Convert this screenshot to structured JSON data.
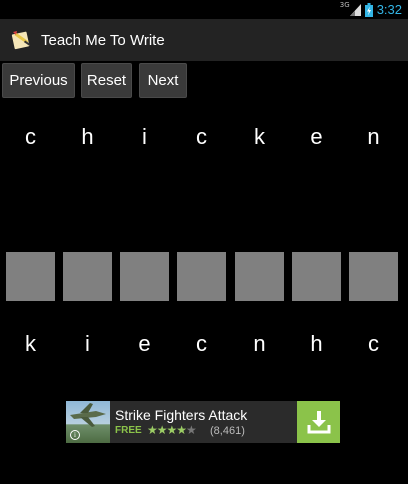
{
  "status_bar": {
    "network_type": "3G",
    "time": "3:32",
    "icons": [
      "signal-icon",
      "battery-charging-icon"
    ]
  },
  "app": {
    "title": "Teach Me To Write",
    "icon": "pencil-notebook-icon"
  },
  "toolbar": {
    "previous_label": "Previous",
    "reset_label": "Reset",
    "next_label": "Next"
  },
  "target_word": {
    "letters": [
      "c",
      "h",
      "i",
      "c",
      "k",
      "e",
      "n"
    ]
  },
  "drop_boxes": {
    "count": 7,
    "color": "#808080"
  },
  "scrambled_letters": {
    "letters": [
      "k",
      "i",
      "e",
      "c",
      "n",
      "h",
      "c"
    ]
  },
  "ad": {
    "title": "Strike Fighters Attack",
    "price_label": "FREE",
    "rating": 4.5,
    "stars": "★★★★",
    "star_empty": "★",
    "reviews": "(8,461)",
    "install_icon": "download-icon",
    "accent_color": "#8bc34a"
  },
  "colors": {
    "background": "#000000",
    "action_bar": "#232323",
    "clock": "#33b5e5"
  }
}
